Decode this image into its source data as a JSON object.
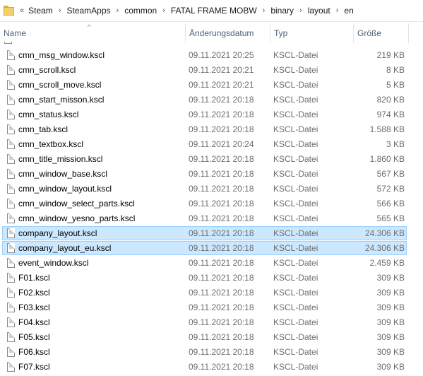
{
  "breadcrumb": [
    "Steam",
    "SteamApps",
    "common",
    "FATAL FRAME MOBW",
    "binary",
    "layout",
    "en"
  ],
  "breadcrumb_overflow": "«",
  "columns": {
    "name": "Name",
    "date": "Änderungsdatum",
    "type": "Typ",
    "size": "Größe"
  },
  "files": [
    {
      "name": "cmn_msg_window.kscl",
      "date": "09.11.2021 20:25",
      "type": "KSCL-Datei",
      "size": "219 KB",
      "selected": false
    },
    {
      "name": "cmn_scroll.kscl",
      "date": "09.11.2021 20:21",
      "type": "KSCL-Datei",
      "size": "8 KB",
      "selected": false
    },
    {
      "name": "cmn_scroll_move.kscl",
      "date": "09.11.2021 20:21",
      "type": "KSCL-Datei",
      "size": "5 KB",
      "selected": false
    },
    {
      "name": "cmn_start_misson.kscl",
      "date": "09.11.2021 20:18",
      "type": "KSCL-Datei",
      "size": "820 KB",
      "selected": false
    },
    {
      "name": "cmn_status.kscl",
      "date": "09.11.2021 20:18",
      "type": "KSCL-Datei",
      "size": "974 KB",
      "selected": false
    },
    {
      "name": "cmn_tab.kscl",
      "date": "09.11.2021 20:18",
      "type": "KSCL-Datei",
      "size": "1.588 KB",
      "selected": false
    },
    {
      "name": "cmn_textbox.kscl",
      "date": "09.11.2021 20:24",
      "type": "KSCL-Datei",
      "size": "3 KB",
      "selected": false
    },
    {
      "name": "cmn_title_mission.kscl",
      "date": "09.11.2021 20:18",
      "type": "KSCL-Datei",
      "size": "1.860 KB",
      "selected": false
    },
    {
      "name": "cmn_window_base.kscl",
      "date": "09.11.2021 20:18",
      "type": "KSCL-Datei",
      "size": "567 KB",
      "selected": false
    },
    {
      "name": "cmn_window_layout.kscl",
      "date": "09.11.2021 20:18",
      "type": "KSCL-Datei",
      "size": "572 KB",
      "selected": false
    },
    {
      "name": "cmn_window_select_parts.kscl",
      "date": "09.11.2021 20:18",
      "type": "KSCL-Datei",
      "size": "566 KB",
      "selected": false
    },
    {
      "name": "cmn_window_yesno_parts.kscl",
      "date": "09.11.2021 20:18",
      "type": "KSCL-Datei",
      "size": "565 KB",
      "selected": false
    },
    {
      "name": "company_layout.kscl",
      "date": "09.11.2021 20:18",
      "type": "KSCL-Datei",
      "size": "24.306 KB",
      "selected": true
    },
    {
      "name": "company_layout_eu.kscl",
      "date": "09.11.2021 20:18",
      "type": "KSCL-Datei",
      "size": "24.306 KB",
      "selected": true
    },
    {
      "name": "event_window.kscl",
      "date": "09.11.2021 20:18",
      "type": "KSCL-Datei",
      "size": "2.459 KB",
      "selected": false
    },
    {
      "name": "F01.kscl",
      "date": "09.11.2021 20:18",
      "type": "KSCL-Datei",
      "size": "309 KB",
      "selected": false
    },
    {
      "name": "F02.kscl",
      "date": "09.11.2021 20:18",
      "type": "KSCL-Datei",
      "size": "309 KB",
      "selected": false
    },
    {
      "name": "F03.kscl",
      "date": "09.11.2021 20:18",
      "type": "KSCL-Datei",
      "size": "309 KB",
      "selected": false
    },
    {
      "name": "F04.kscl",
      "date": "09.11.2021 20:18",
      "type": "KSCL-Datei",
      "size": "309 KB",
      "selected": false
    },
    {
      "name": "F05.kscl",
      "date": "09.11.2021 20:18",
      "type": "KSCL-Datei",
      "size": "309 KB",
      "selected": false
    },
    {
      "name": "F06.kscl",
      "date": "09.11.2021 20:18",
      "type": "KSCL-Datei",
      "size": "309 KB",
      "selected": false
    },
    {
      "name": "F07.kscl",
      "date": "09.11.2021 20:18",
      "type": "KSCL-Datei",
      "size": "309 KB",
      "selected": false
    }
  ],
  "icons": {
    "folder": "folder-icon",
    "file": "file-icon"
  },
  "colors": {
    "selection_bg": "#cce8ff",
    "selection_border": "#99d1ff",
    "header_text": "#4c607a",
    "secondary_text": "#6d6d6d"
  }
}
